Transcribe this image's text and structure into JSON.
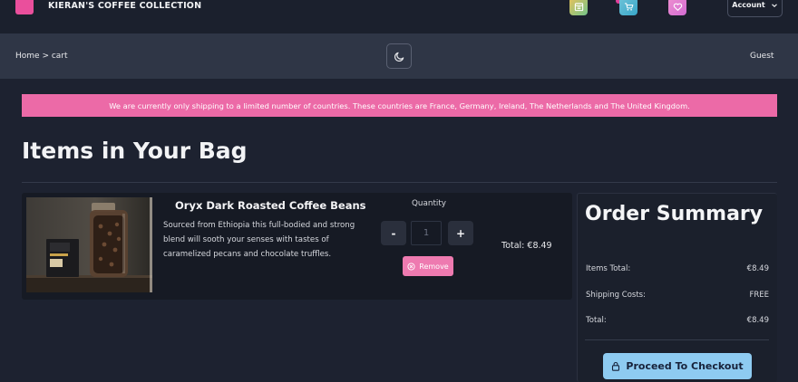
{
  "brand": {
    "name": "KIERAN'S COFFEE COLLECTION"
  },
  "nav": {
    "icons": [
      "calendar-icon",
      "cart-icon",
      "heart-icon"
    ],
    "account_label": "Account"
  },
  "breadcrumb": {
    "text": "Home > cart"
  },
  "user": {
    "label": "Guest"
  },
  "banner": {
    "text": "We are currently only shipping to a limited number of countries. These countries are France, Germany, Ireland, The Netherlands and The United Kingdom."
  },
  "page": {
    "title": "Items in Your Bag"
  },
  "cart_item": {
    "name": "Oryx Dark Roasted Coffee Beans",
    "description": "Sourced from Ethiopia this full-bodied and strong blend will sooth your senses with tastes of caramelized pecans and chocolate truffles.",
    "quantity_label": "Quantity",
    "quantity_value": "1",
    "minus_label": "-",
    "plus_label": "+",
    "remove_label": "Remove",
    "total_text": "Total: €8.49"
  },
  "summary": {
    "title": "Order Summary",
    "items_total_label": "Items Total:",
    "items_total_value": "€8.49",
    "shipping_label": "Shipping Costs:",
    "shipping_value": "FREE",
    "total_label": "Total:",
    "total_value": "€8.49",
    "checkout_label": "Proceed To Checkout"
  },
  "colors": {
    "brand_pink": "#ec6aa7",
    "checkout_blue": "#8ecbf1",
    "background": "#1d2230"
  }
}
